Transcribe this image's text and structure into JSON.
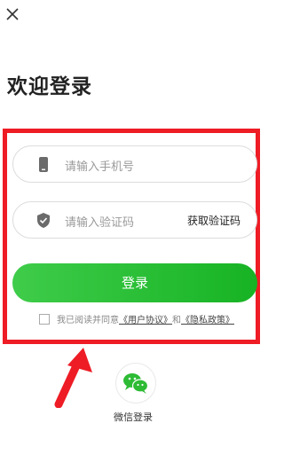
{
  "header": {
    "title": "欢迎登录"
  },
  "form": {
    "phone_placeholder": "请输入手机号",
    "code_placeholder": "请输入验证码",
    "get_code_label": "获取验证码",
    "login_label": "登录"
  },
  "agreement": {
    "prefix": "我已阅读并同意",
    "user_agreement": "《用户协议》",
    "and": "和",
    "privacy_policy": "《隐私政策》"
  },
  "social": {
    "wechat_label": "微信登录"
  },
  "colors": {
    "accent_green": "#17b324",
    "highlight_red": "#ee1c25"
  },
  "icons": [
    "close-icon",
    "phone-icon",
    "shield-icon",
    "wechat-icon",
    "arrow-annotation"
  ]
}
